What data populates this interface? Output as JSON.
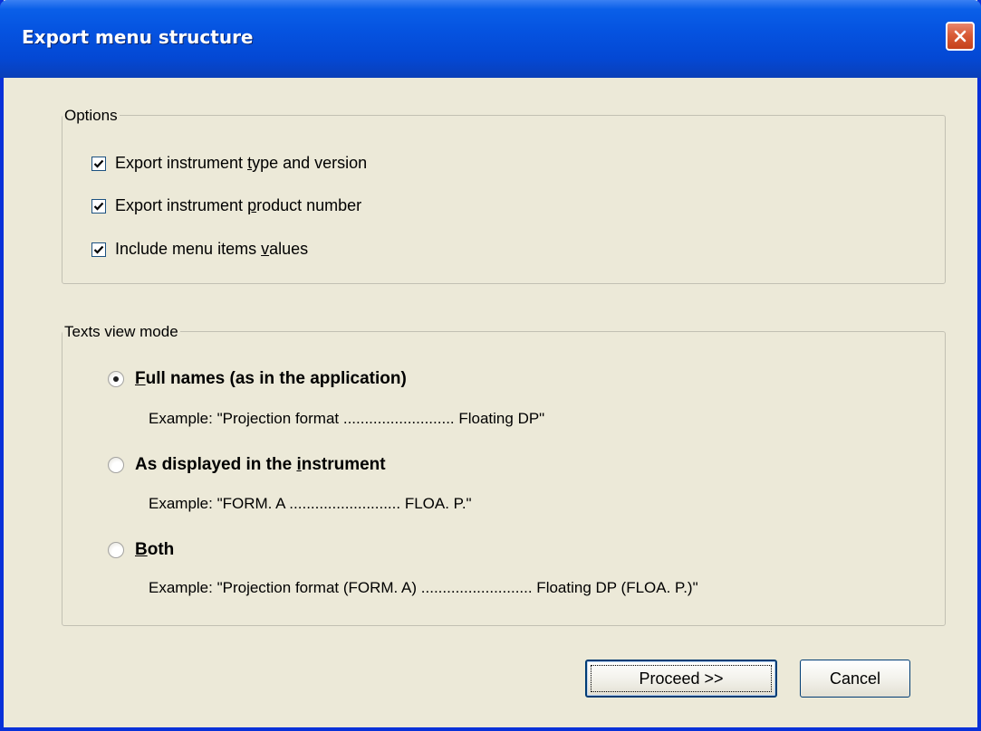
{
  "window": {
    "title": "Export menu structure",
    "close_icon": "close-x-icon"
  },
  "options": {
    "legend": "Options",
    "items": [
      {
        "before": "Export instrument ",
        "mnemonic": "t",
        "after": "ype and version",
        "checked": true
      },
      {
        "before": "Export instrument ",
        "mnemonic": "p",
        "after": "roduct number",
        "checked": true
      },
      {
        "before": "Include menu items ",
        "mnemonic": "v",
        "after": "alues",
        "checked": true
      }
    ]
  },
  "view_mode": {
    "legend": "Texts view mode",
    "choices": [
      {
        "before": "",
        "mnemonic": "F",
        "after": "ull names (as in the application)",
        "selected": true,
        "example": "Example: \"Projection format .......................... Floating DP\""
      },
      {
        "before": "As displayed in the ",
        "mnemonic": "i",
        "after": "nstrument",
        "selected": false,
        "example": "Example: \"FORM. A .......................... FLOA. P.\""
      },
      {
        "before": "",
        "mnemonic": "B",
        "after": "oth",
        "selected": false,
        "example": "Example: \"Projection format (FORM. A) .......................... Floating DP (FLOA. P.)\""
      }
    ]
  },
  "buttons": {
    "proceed_label": "Proceed >>",
    "cancel_label": "Cancel"
  },
  "colors": {
    "titlebar": "#0553e0",
    "dialog_bg": "#ece9d8",
    "close_button": "#d95b36"
  }
}
